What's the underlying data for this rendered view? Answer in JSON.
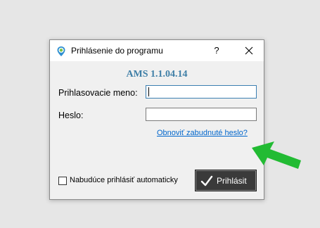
{
  "window": {
    "title": "Prihlásenie do programu",
    "help_label": "?",
    "app_icon": "location-pin-icon",
    "close_icon": "close-icon"
  },
  "form": {
    "app_version": "AMS 1.1.04.14",
    "username_label": "Prihlasovacie meno:",
    "username_value": "",
    "password_label": "Heslo:",
    "password_value": "",
    "forgot_password_link": "Obnoviť zabudnuté heslo?",
    "auto_login_label": "Nabudúce prihlásiť automaticky",
    "auto_login_checked": false,
    "login_button_label": "Prihlásit",
    "login_button_icon": "checkmark-icon"
  },
  "annotation": {
    "arrow_icon": "green-arrow-icon",
    "arrow_color": "#22bb33"
  },
  "colors": {
    "title_accent": "#3e7ea6",
    "link": "#0066cc",
    "button_bg": "#3a3a3a"
  }
}
